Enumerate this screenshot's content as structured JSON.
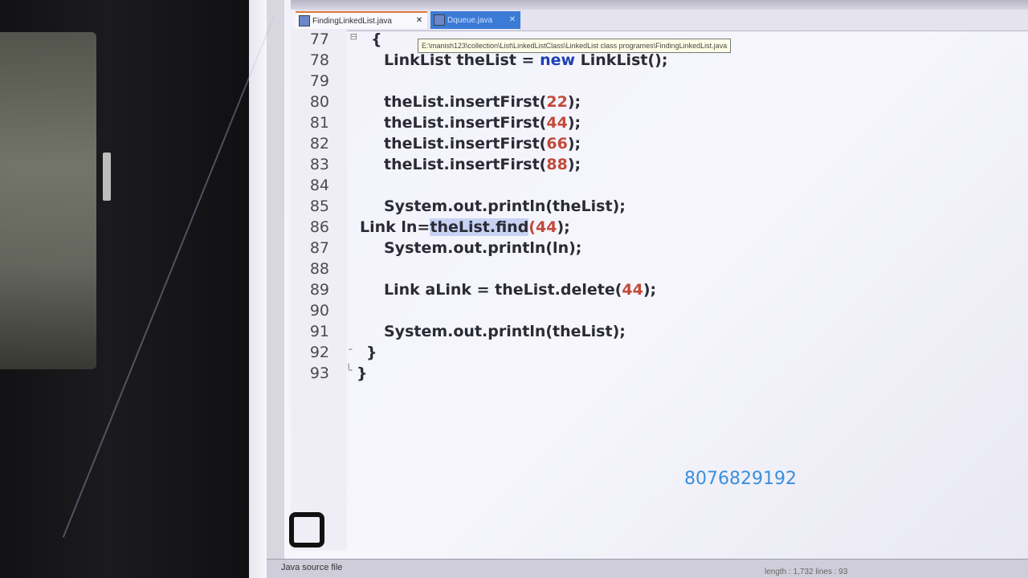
{
  "tabs": [
    {
      "label": "FindingLinkedList.java",
      "active": true
    },
    {
      "label": "Dqueue.java",
      "active": false
    }
  ],
  "tooltip": "E:\\manish123\\collection\\List\\LinkedListClass\\LinkedList class programes\\FindingLinkedList.java",
  "code_lines": [
    {
      "n": "77",
      "text": "{"
    },
    {
      "n": "78",
      "text": "LinkList theList = new LinkList();"
    },
    {
      "n": "79",
      "text": ""
    },
    {
      "n": "80",
      "text": "theList.insertFirst(22);"
    },
    {
      "n": "81",
      "text": "theList.insertFirst(44);"
    },
    {
      "n": "82",
      "text": "theList.insertFirst(66);"
    },
    {
      "n": "83",
      "text": "theList.insertFirst(88);"
    },
    {
      "n": "84",
      "text": ""
    },
    {
      "n": "85",
      "text": "System.out.println(theList);"
    },
    {
      "n": "86",
      "text": "Link ln=theList.find(44);"
    },
    {
      "n": "87",
      "text": "System.out.println(ln);"
    },
    {
      "n": "88",
      "text": ""
    },
    {
      "n": "89",
      "text": "Link aLink = theList.delete(44);"
    },
    {
      "n": "90",
      "text": ""
    },
    {
      "n": "91",
      "text": "System.out.println(theList);"
    },
    {
      "n": "92",
      "text": "}"
    },
    {
      "n": "93",
      "text": "}"
    }
  ],
  "tokens": {
    "line78": {
      "a": "LinkList theList = ",
      "kw": "new",
      "b": " LinkList();"
    },
    "line80": {
      "a": "theList.insertFirst(",
      "num": "22",
      "b": ");"
    },
    "line81": {
      "a": "theList.insertFirst(",
      "num": "44",
      "b": ");"
    },
    "line82": {
      "a": "theList.insertFirst(",
      "num": "66",
      "b": ");"
    },
    "line83": {
      "a": "theList.insertFirst(",
      "num": "88",
      "b": ");"
    },
    "line86": {
      "a": "Link ln=",
      "sel": "theList.find",
      "paren": "(",
      "num": "44",
      "b": ");"
    },
    "line89": {
      "a": "Link aLink = theList.delete(",
      "num": "44",
      "b": ");"
    }
  },
  "overlay_number": "8076829192",
  "status": {
    "left": "Java source file",
    "right": "length : 1,732    lines : 93"
  },
  "colors": {
    "number_literal": "#c24a3a",
    "keyword": "#1e3fb5",
    "overlay_text": "#3a8fdc",
    "active_tab_accent": "#e07a3a"
  }
}
